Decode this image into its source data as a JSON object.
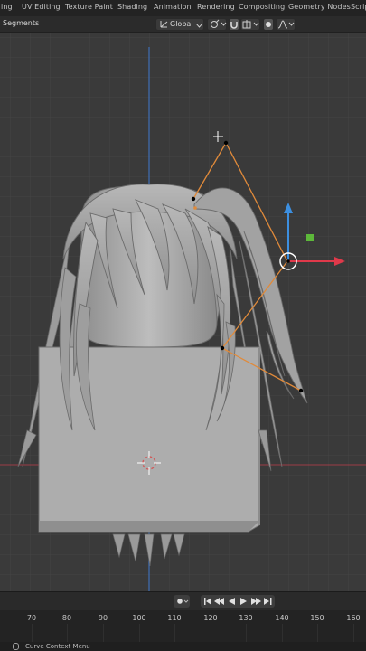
{
  "workspace_tabs": [
    "ing",
    "UV Editing",
    "Texture Paint",
    "Shading",
    "Animation",
    "Rendering",
    "Compositing",
    "Geometry Nodes",
    "Scrip"
  ],
  "toolbar": {
    "mode_label": "Segments",
    "transform_orientation": "Global",
    "transform_icon": "orientation-axes-icon",
    "pivot_icon": "pivot-point-icon",
    "snap_icon": "magnet-icon",
    "snap_target_icon": "snap-increment-icon",
    "proportional_icon": "proportional-edit-icon",
    "falloff_icon": "falloff-curve-icon"
  },
  "viewport": {
    "grid_color": "#444444",
    "z_axis_color": "#3f6eb5",
    "x_axis_color": "#b53d4a",
    "handle_color": "#e08a3a",
    "gizmo_y_color": "#3c8fe0",
    "gizmo_x_color": "#e0394a",
    "gizmo_plane_color": "#5db83a",
    "mesh_color": "#a8a8a8",
    "icons": [
      "3d-cursor-icon",
      "transform-gizmo-icon",
      "world-origin-icon"
    ]
  },
  "timeline": {
    "frame_ticks": [
      "70",
      "80",
      "90",
      "100",
      "110",
      "120",
      "130",
      "140",
      "150",
      "160"
    ],
    "playback_icons": [
      "keyframe-dot-icon",
      "jump-start-icon",
      "prev-keyframe-icon",
      "play-reverse-icon",
      "play-icon",
      "next-keyframe-icon",
      "jump-end-icon"
    ]
  },
  "statusbar": {
    "text": "Curve Context Menu",
    "icon": "mouse-right-click-icon"
  }
}
